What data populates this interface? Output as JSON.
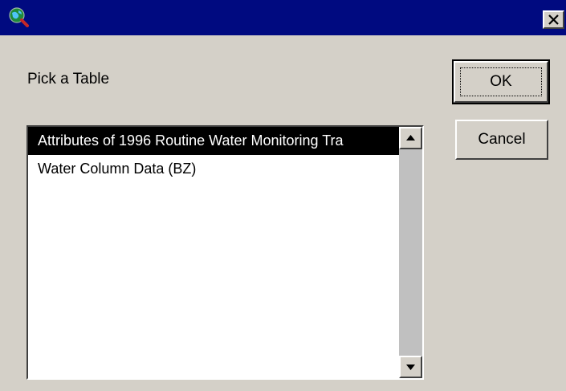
{
  "window": {
    "title": "",
    "icon": "globe-magnifier-icon",
    "close_icon": "close-icon"
  },
  "dialog": {
    "prompt": "Pick a Table",
    "ok_label": "OK",
    "cancel_label": "Cancel"
  },
  "table_list": {
    "items": [
      {
        "label": "Attributes of 1996 Routine Water Monitoring Tra",
        "selected": true
      },
      {
        "label": "Water Column Data (BZ)",
        "selected": false
      }
    ]
  },
  "scrollbar": {
    "up_icon": "arrow-up-icon",
    "down_icon": "arrow-down-icon"
  },
  "colors": {
    "titlebar": "#000a80",
    "face": "#d4d0c8",
    "selection": "#000000"
  }
}
